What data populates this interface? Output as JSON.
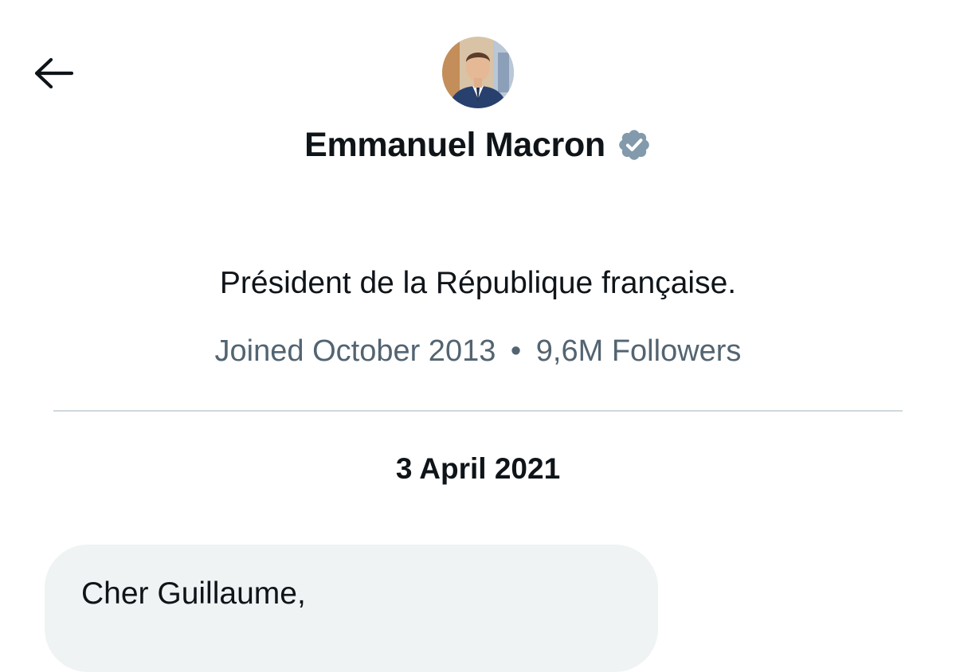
{
  "header": {
    "back_icon": "arrow-left-icon",
    "avatar_icon": "profile-avatar"
  },
  "profile": {
    "display_name": "Emmanuel Macron",
    "verified_icon": "verified-badge-icon",
    "verified_color": "#829aab",
    "bio": "Président de la République française.",
    "joined": "Joined October 2013",
    "separator": "•",
    "followers": "9,6M Followers"
  },
  "conversation": {
    "date": "3 April 2021",
    "messages": [
      {
        "text": "Cher Guillaume,"
      }
    ]
  },
  "colors": {
    "text_primary": "#0f1419",
    "text_secondary": "#536471",
    "divider": "#cfd9de",
    "bubble_bg": "#eff3f4"
  }
}
